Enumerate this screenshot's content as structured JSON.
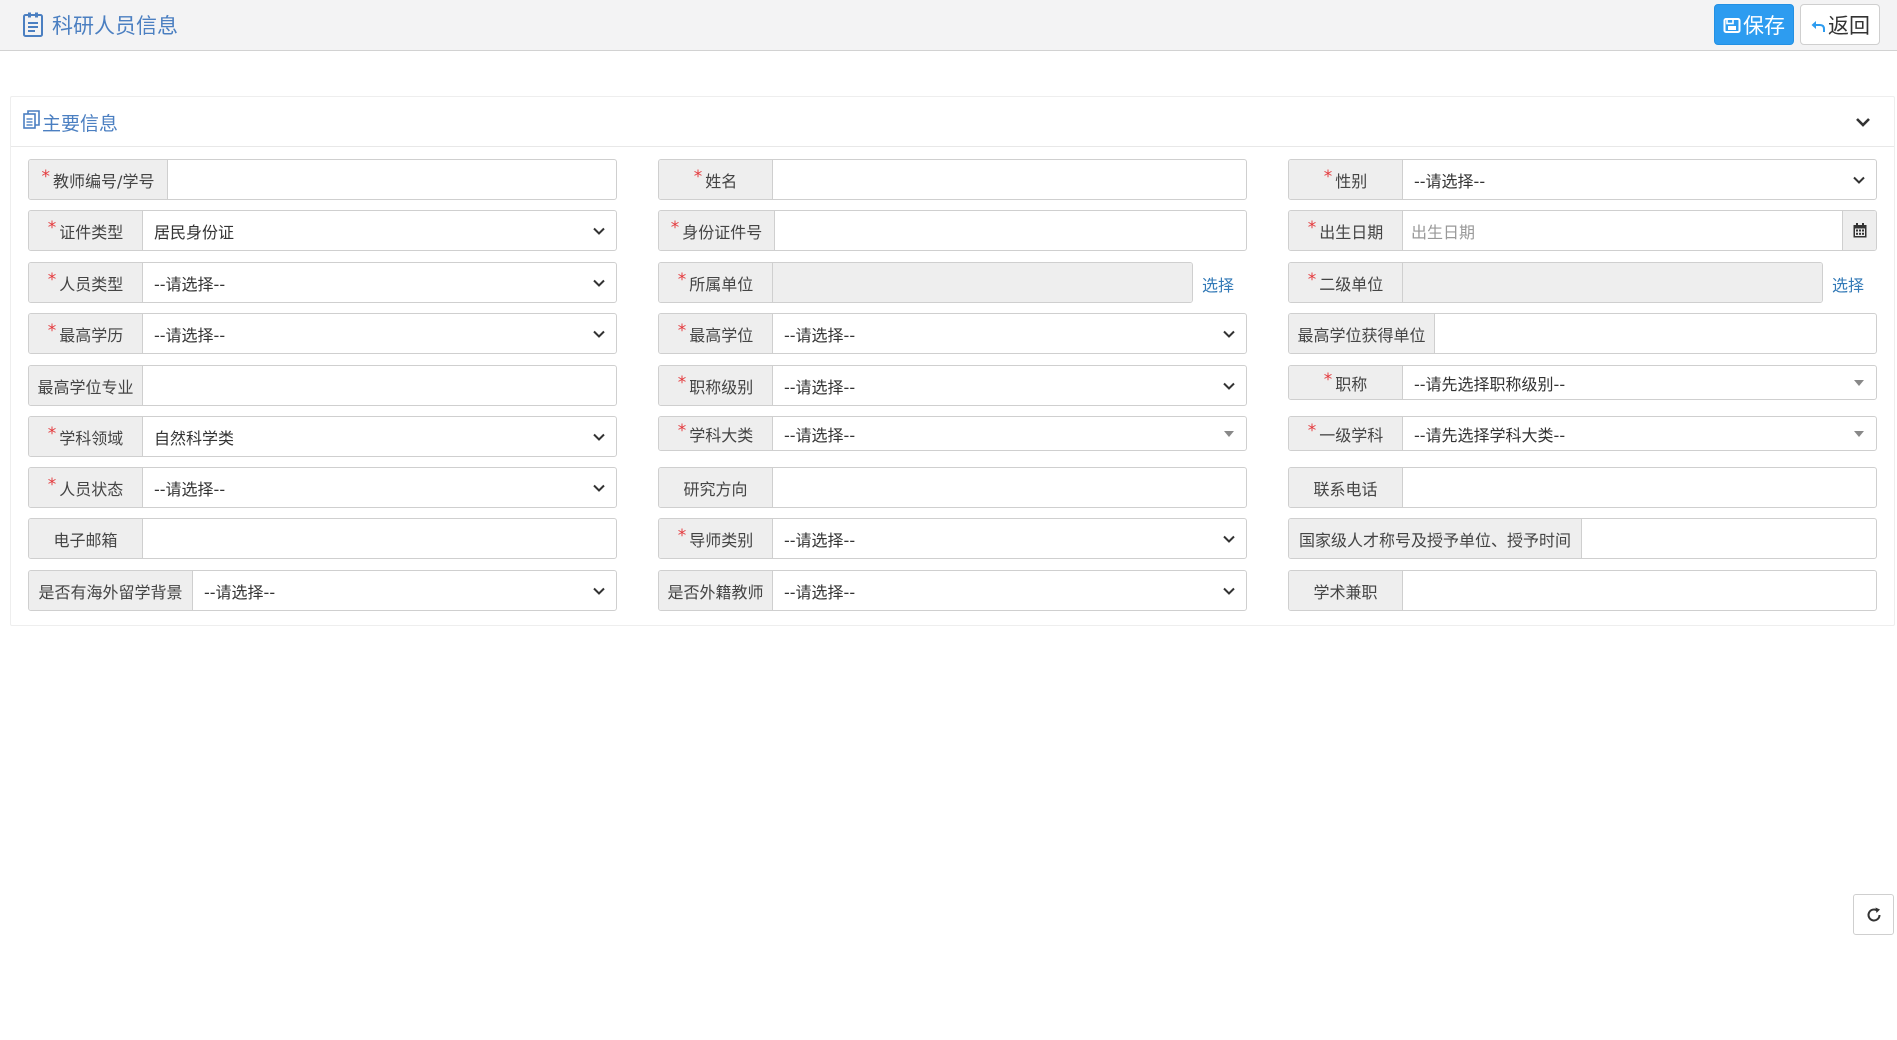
{
  "header": {
    "title": "科研人员信息",
    "save_label": "保存",
    "back_label": "返回"
  },
  "panel": {
    "title": "主要信息"
  },
  "select_link_label": "选择",
  "colors": {
    "accent": "#2d9cf0",
    "title_blue": "#4b7fc1",
    "required": "#e4393c",
    "link": "#337ab7"
  },
  "fields": {
    "teacher_id": {
      "label": "教师编号/学号",
      "value": ""
    },
    "name": {
      "label": "姓名",
      "value": ""
    },
    "gender": {
      "label": "性别",
      "value": "--请选择--"
    },
    "id_type": {
      "label": "证件类型",
      "value": "居民身份证"
    },
    "id_number": {
      "label": "身份证件号",
      "value": ""
    },
    "birth_date": {
      "label": "出生日期",
      "placeholder": "出生日期"
    },
    "person_type": {
      "label": "人员类型",
      "value": "--请选择--"
    },
    "unit": {
      "label": "所属单位",
      "value": ""
    },
    "sub_unit": {
      "label": "二级单位",
      "value": ""
    },
    "edu": {
      "label": "最高学历",
      "value": "--请选择--"
    },
    "degree": {
      "label": "最高学位",
      "value": "--请选择--"
    },
    "degree_org": {
      "label": "最高学位获得单位",
      "value": ""
    },
    "degree_major": {
      "label": "最高学位专业",
      "value": ""
    },
    "title_level": {
      "label": "职称级别",
      "value": "--请选择--"
    },
    "title": {
      "label": "职称",
      "value": "--请先选择职称级别--"
    },
    "field_area": {
      "label": "学科领域",
      "value": "自然科学类"
    },
    "discipline": {
      "label": "学科大类",
      "value": "--请选择--"
    },
    "first_disc": {
      "label": "一级学科",
      "value": "--请先选择学科大类--"
    },
    "status": {
      "label": "人员状态",
      "value": "--请选择--"
    },
    "research": {
      "label": "研究方向",
      "value": ""
    },
    "phone": {
      "label": "联系电话",
      "value": ""
    },
    "email": {
      "label": "电子邮箱",
      "value": ""
    },
    "mentor_type": {
      "label": "导师类别",
      "value": "--请选择--"
    },
    "talent_title": {
      "label": "国家级人才称号及授予单位、授予时间",
      "value": ""
    },
    "overseas": {
      "label": "是否有海外留学背景",
      "value": "--请选择--"
    },
    "foreign": {
      "label": "是否外籍教师",
      "value": "--请选择--"
    },
    "academic": {
      "label": "学术兼职",
      "value": ""
    }
  },
  "icons": {
    "title": "document-list-icon",
    "save": "floppy-disk-icon",
    "back": "reply-arrow-icon",
    "panel": "copy-documents-icon",
    "collapse": "chevron-down-icon",
    "select": "chevron-down-icon",
    "calendar": "calendar-icon",
    "refresh": "refresh-icon"
  }
}
